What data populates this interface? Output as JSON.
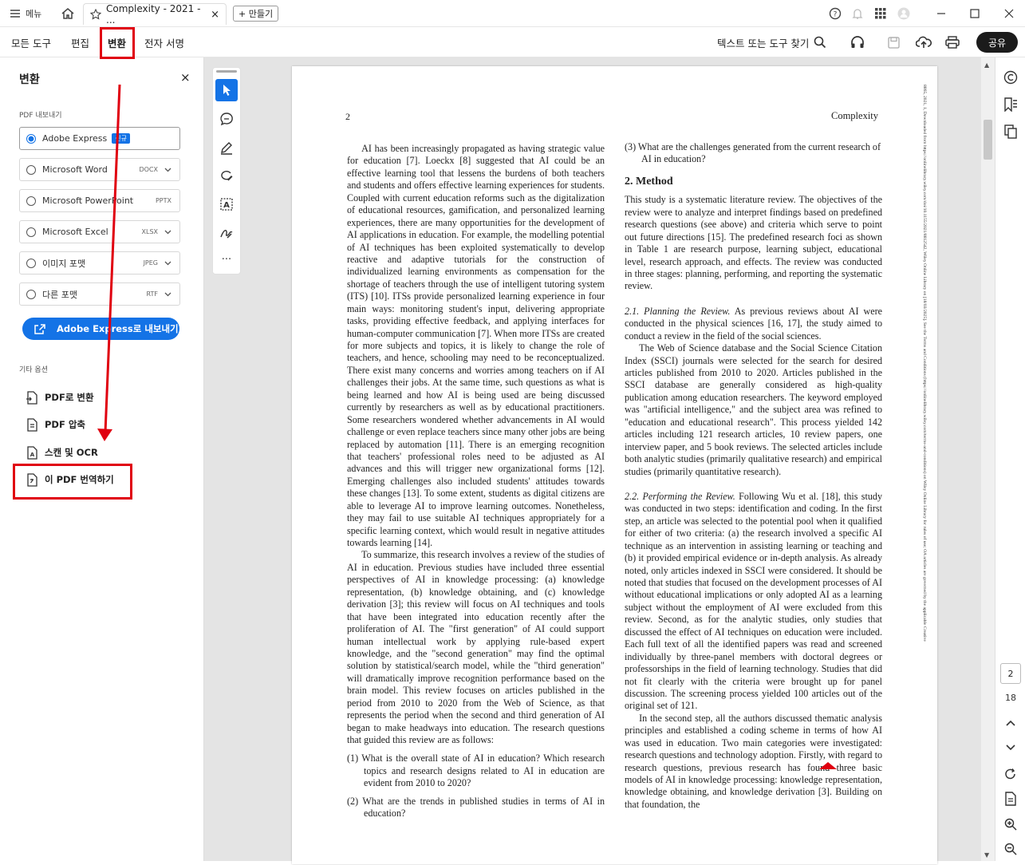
{
  "titlebar": {
    "menu_label": "메뉴",
    "tab_title": "Complexity - 2021 - ...",
    "new_tab_label": "+ 만들기"
  },
  "menubar": {
    "all_tools": "모든 도구",
    "edit": "편집",
    "convert": "변환",
    "esign": "전자 서명",
    "search_label": "텍스트 또는 도구 찾기",
    "share": "공유"
  },
  "panel": {
    "title": "변환",
    "export_label": "PDF 내보내기",
    "formats": [
      {
        "name": "Adobe Express",
        "badge": "신규",
        "ext": ""
      },
      {
        "name": "Microsoft Word",
        "ext": "DOCX"
      },
      {
        "name": "Microsoft PowerPoint",
        "ext": "PPTX"
      },
      {
        "name": "Microsoft Excel",
        "ext": "XLSX"
      },
      {
        "name": "이미지 포맷",
        "ext": "JPEG"
      },
      {
        "name": "다른 포맷",
        "ext": "RTF"
      }
    ],
    "export_button": "Adobe Express로 내보내기",
    "other_label": "기타 옵션",
    "options": [
      "PDF로 변환",
      "PDF 압축",
      "스캔 및 OCR",
      "이 PDF 번역하기"
    ]
  },
  "page_nav": {
    "current": "2",
    "total": "18"
  },
  "doc": {
    "page_number": "2",
    "running_head": "Complexity",
    "side_note": "8865, 2021, 1, Downloaded from https://onlinelibrary.wiley.com/doi/10.1155/2021/8812542, Wiley Online Library on [18/03/2025]. See the Terms and Conditions (https://onlinelibrary.wiley.com/terms-and-conditions) on Wiley Online Library for rules of use; OA articles are governed by the applicable Creative",
    "left_col": [
      "AI has been increasingly propagated as having strategic value for education [7]. Loeckx [8] suggested that AI could be an effective learning tool that lessens the burdens of both teachers and students and offers effective learning experiences for students. Coupled with current education reforms such as the digitalization of educational resources, gamification, and personalized learning experiences, there are many opportunities for the development of AI applications in education. For example, the modelling potential of AI techniques has been exploited systematically to develop reactive and adaptive tutorials for the construction of individualized learning environments as compensation for the shortage of teachers through the use of intelligent tutoring system (ITS) [10]. ITSs provide personalized learning experience in four main ways: monitoring student's input, delivering appropriate tasks, providing effective feedback, and applying interfaces for human-computer communication [7]. When more ITSs are created for more subjects and topics, it is likely to change the role of teachers, and hence, schooling may need to be reconceptualized. There exist many concerns and worries among teachers on if AI challenges their jobs. At the same time, such questions as what is being learned and how AI is being used are being discussed currently by researchers as well as by educational practitioners. Some researchers wondered whether advancements in AI would challenge or even replace teachers since many other jobs are being replaced by automation [11]. There is an emerging recognition that teachers' professional roles need to be adjusted as AI advances and this will trigger new organizational forms [12]. Emerging challenges also included students' attitudes towards these changes [13]. To some extent, students as digital citizens are able to leverage AI to improve learning outcomes. Nonetheless, they may fail to use suitable AI techniques appropriately for a specific learning context, which would result in negative attitudes towards learning [14].",
      "To summarize, this research involves a review of the studies of AI in education. Previous studies have included three essential perspectives of AI in knowledge processing: (a) knowledge representation, (b) knowledge obtaining, and (c) knowledge derivation [3]; this review will focus on AI techniques and tools that have been integrated into education recently after the proliferation of AI. The \"first generation\" of AI could support human intellectual work by applying rule-based expert knowledge, and the \"second generation\" may find the optimal solution by statistical/search model, while the \"third generation\" will dramatically improve recognition performance based on the brain model. This review focuses on articles published in the period from 2010 to 2020 from the Web of Science, as that represents the period when the second and third generation of AI began to make headways into education. The research questions that guided this review are as follows:"
    ],
    "questions": [
      "(1) What is the overall state of AI in education? Which research topics and research designs related to AI in education are evident from 2010 to 2020?",
      "(2) What are the trends in published studies in terms of AI in education?",
      "(3) What are the challenges generated from the current research of AI in education?"
    ],
    "method_heading": "2. Method",
    "method_p": "This study is a systematic literature review. The objectives of the review were to analyze and interpret findings based on predefined research questions (see above) and criteria which serve to point out future directions [15]. The predefined research foci as shown in Table 1 are research purpose, learning subject, educational level, research approach, and effects. The review was conducted in three stages: planning, performing, and reporting the systematic review.",
    "s21_head": "2.1. Planning the Review.",
    "s21_p": "As previous reviews about AI were conducted in the physical sciences [16, 17], the study aimed to conduct a review in the field of the social sciences.",
    "s21_p2": "The Web of Science database and the Social Science Citation Index (SSCI) journals were selected for the search for desired articles published from 2010 to 2020. Articles published in the SSCI database are generally considered as high-quality publication among education researchers. The keyword employed was \"artificial intelligence,\" and the subject area was refined to \"education and educational research\". This process yielded 142 articles including 121 research articles, 10 review papers, one interview paper, and 5 book reviews. The selected articles include both analytic studies (primarily qualitative research) and empirical studies (primarily quantitative research).",
    "s22_head": "2.2. Performing the Review.",
    "s22_p": "Following Wu et al. [18], this study was conducted in two steps: identification and coding. In the first step, an article was selected to the potential pool when it qualified for either of two criteria: (a) the research involved a specific AI technique as an intervention in assisting learning or teaching and (b) it provided empirical evidence or in-depth analysis. As already noted, only articles indexed in SSCI were considered. It should be noted that studies that focused on the development processes of AI without educational implications or only adopted AI as a learning subject without the employment of AI were excluded from this review. Second, as for the analytic studies, only studies that discussed the effect of AI techniques on education were included. Each full text of all the identified papers was read and screened individually by three-panel members with doctoral degrees or professorships in the field of learning technology. Studies that did not fit clearly with the criteria were brought up for panel discussion. The screening process yielded 100 articles out of the original set of 121.",
    "s22_p2": "In the second step, all the authors discussed thematic analysis principles and established a coding scheme in terms of how AI was used in education. Two main categories were investigated: research questions and technology adoption. Firstly, with regard to research questions, previous research has found three basic models of AI in knowledge processing: knowledge representation, knowledge obtaining, and knowledge derivation [3]. Building on that foundation, the"
  },
  "colors": {
    "accent": "#1473e6",
    "highlight": "#e00010",
    "dark": "#1b1b1b"
  }
}
